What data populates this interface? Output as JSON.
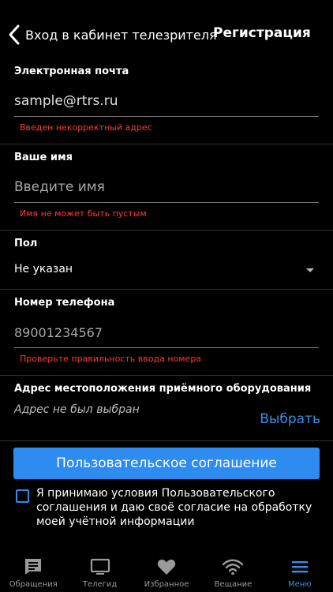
{
  "nav": {
    "back_label": "Вход в кабинет телезрителя",
    "title": "Регистрация"
  },
  "email": {
    "label": "Электронная почта",
    "value": "sample@rtrs.ru",
    "error": "Введен некорректный адрес"
  },
  "name": {
    "label": "Ваше имя",
    "placeholder": "Введите имя",
    "error": "Имя не может быть пустым"
  },
  "gender": {
    "label": "Пол",
    "selected": "Не указан"
  },
  "phone": {
    "label": "Номер телефона",
    "placeholder": "89001234567",
    "error": "Проверьте правильность ввода номера"
  },
  "address": {
    "label": "Адрес местоположения приёмного оборудования",
    "empty_text": "Адрес не был выбран",
    "choose_label": "Выбрать"
  },
  "agreement": {
    "button_label": "Пользовательское соглашение",
    "consent_text": "Я принимаю условия Пользовательского соглашения и даю своё согласие на обработку моей учётной информации",
    "checked": false
  },
  "tabbar": {
    "tabs": [
      {
        "label": "Обращения",
        "icon": "message-icon",
        "active": false
      },
      {
        "label": "Телегид",
        "icon": "tv-icon",
        "active": false
      },
      {
        "label": "Избранное",
        "icon": "heart-icon",
        "active": false
      },
      {
        "label": "Вещание",
        "icon": "wifi-icon",
        "active": false
      },
      {
        "label": "Меню",
        "icon": "menu-icon",
        "active": true
      }
    ]
  },
  "colors": {
    "accent": "#2e8bf0",
    "error": "#ff3b30",
    "background": "#000000"
  }
}
